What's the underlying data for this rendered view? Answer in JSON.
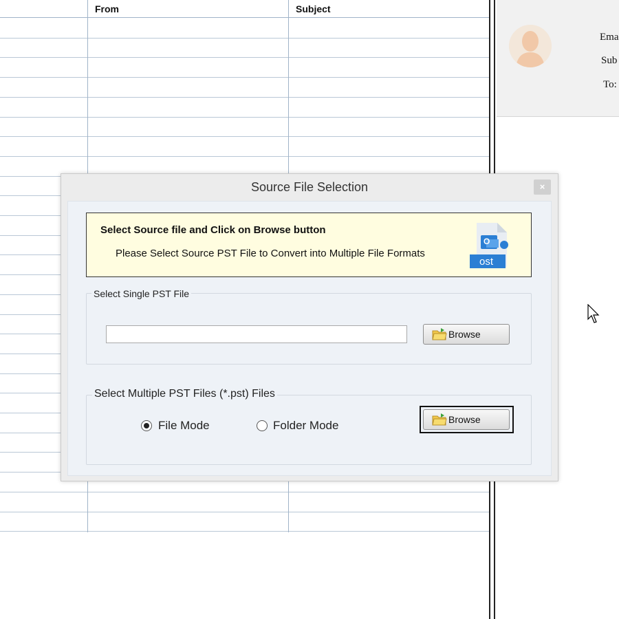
{
  "grid": {
    "columns": [
      "",
      "From",
      "Subject"
    ],
    "row_count": 26
  },
  "preview": {
    "email_label": "Ema",
    "subject_label": "Sub",
    "to_label": "To:"
  },
  "dialog": {
    "title": "Source File Selection",
    "close_label": "×",
    "banner": {
      "title": "Select Source file and Click on Browse button",
      "subtitle": "Please Select Source PST File to Convert into Multiple File Formats",
      "icon_text": "ost",
      "icon_letter": "O"
    },
    "single": {
      "group_label": "Select Single PST File",
      "path_value": "",
      "browse_label": "Browse"
    },
    "multiple": {
      "group_label": "Select Multiple PST Files (*.pst) Files",
      "file_mode_label": "File Mode",
      "folder_mode_label": "Folder Mode",
      "selected_mode": "file",
      "browse_label": "Browse"
    }
  },
  "colors": {
    "grid_lines": "#9fb3c8",
    "banner_bg": "#fffde0",
    "ost_icon_blue": "#2b7fd4",
    "dialog_bg": "#eef2f7"
  }
}
